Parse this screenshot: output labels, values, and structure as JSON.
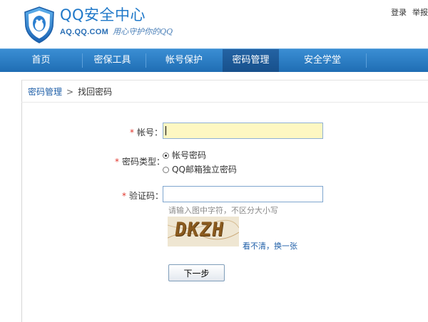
{
  "header": {
    "brand_title": "QQ安全中心",
    "brand_domain": "AQ.QQ.COM",
    "brand_slogan": "用心守护你的QQ",
    "top_links": [
      "登录",
      "举报"
    ]
  },
  "nav": {
    "items": [
      {
        "label": "首页",
        "active": false
      },
      {
        "label": "密保工具",
        "active": false
      },
      {
        "label": "帐号保护",
        "active": false
      },
      {
        "label": "密码管理",
        "active": true
      },
      {
        "label": "安全学堂",
        "active": false
      }
    ]
  },
  "breadcrumb": {
    "parent": "密码管理",
    "separator": ">",
    "current": "找回密码"
  },
  "form": {
    "required_mark": "*",
    "account": {
      "label": "帐号：",
      "value": ""
    },
    "password_type": {
      "label": "密码类型：",
      "options": [
        {
          "label": "帐号密码",
          "checked": true
        },
        {
          "label": "QQ邮箱独立密码",
          "checked": false
        }
      ]
    },
    "captcha": {
      "label": "验证码：",
      "value": "",
      "hint": "请输入图中字符，不区分大小写",
      "image_text": "DKZH",
      "refresh_link": "看不清，换一张"
    },
    "next_button": "下一步"
  },
  "colors": {
    "brand_blue": "#1f78c9",
    "nav_bg": "#2a7cc7",
    "nav_active": "#1d5c9c",
    "required_red": "#e0362c",
    "link_blue": "#1f5fa8",
    "focused_input_bg": "#fdf7c2"
  }
}
